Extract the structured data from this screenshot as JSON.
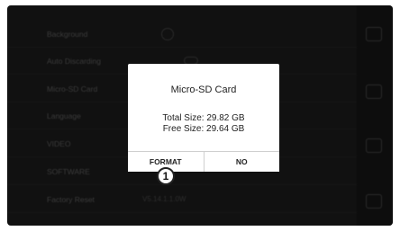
{
  "settings": {
    "rows": [
      {
        "label": "Background",
        "value": ""
      },
      {
        "label": "Auto Discarding",
        "value": ""
      },
      {
        "label": "Micro-SD Card",
        "value": ""
      },
      {
        "label": "Language",
        "value": ""
      },
      {
        "label": "VIDEO",
        "value": ""
      },
      {
        "label": "SOFTWARE",
        "value": ""
      },
      {
        "label": "Factory Reset",
        "value": "V5.14.1.1.0W"
      }
    ]
  },
  "side_panel": {
    "icons": [
      "home-icon",
      "settings-icon",
      "monitor-icon",
      "back-icon"
    ]
  },
  "dialog": {
    "title": "Micro-SD Card",
    "total_size": "Total Size: 29.82 GB",
    "free_size": "Free Size: 29.64 GB",
    "format_label": "FORMAT",
    "no_label": "NO"
  },
  "callout": {
    "number": "1"
  }
}
